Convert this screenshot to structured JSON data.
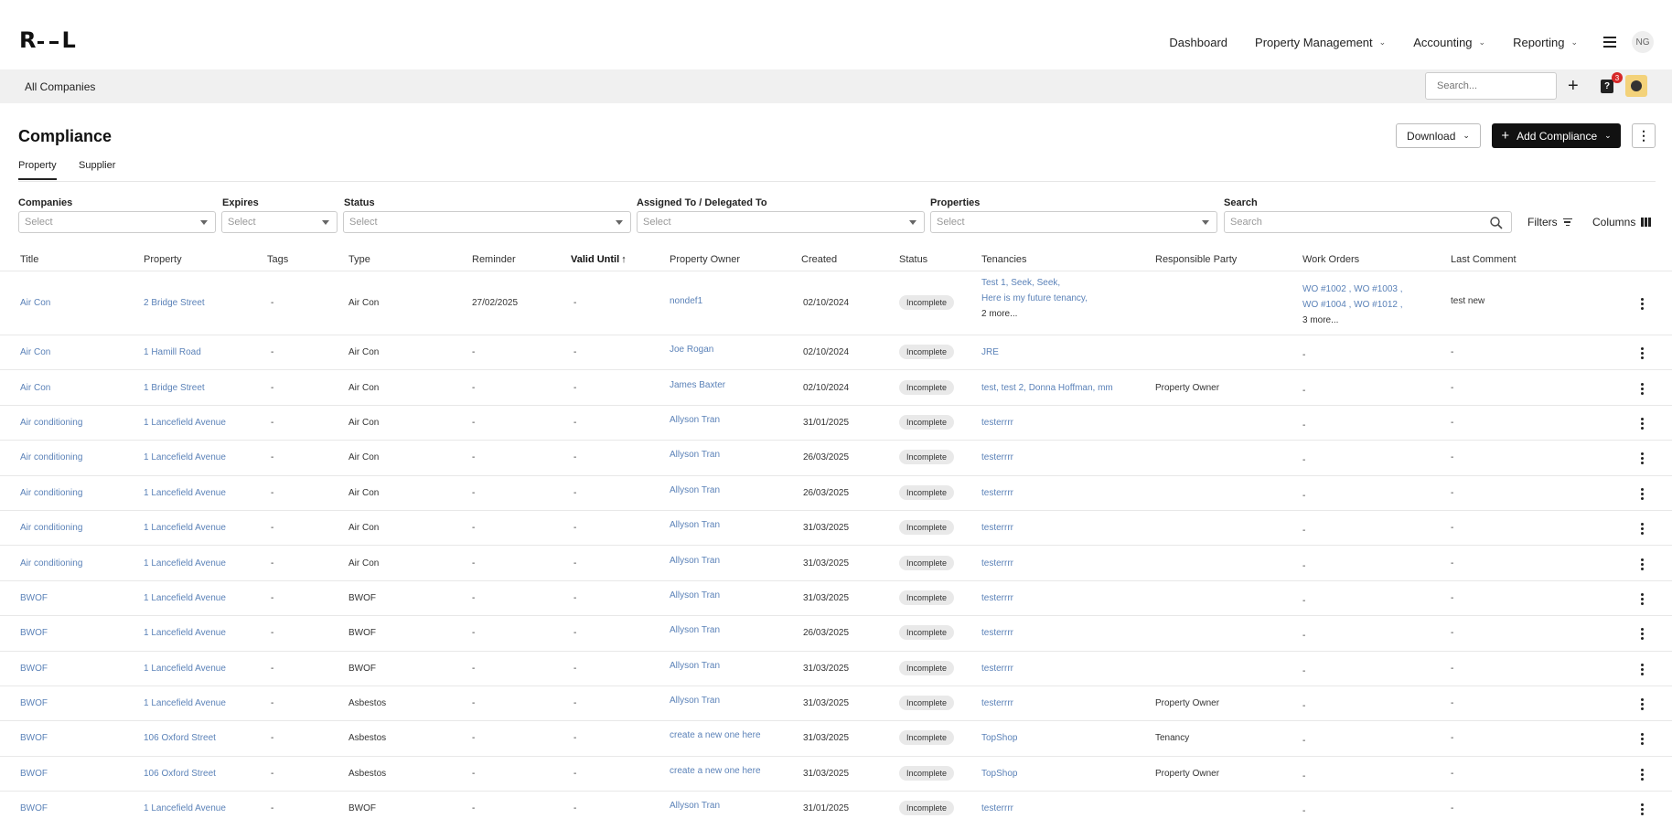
{
  "nav": {
    "logo_left": "R",
    "logo_right": "L",
    "links": [
      {
        "label": "Dashboard",
        "dropdown": false
      },
      {
        "label": "Property Management",
        "dropdown": true
      },
      {
        "label": "Accounting",
        "dropdown": true
      },
      {
        "label": "Reporting",
        "dropdown": true
      }
    ],
    "avatar": "NG"
  },
  "subbar": {
    "company": "All Companies",
    "search_placeholder": "Search...",
    "help_badge": "3"
  },
  "page": {
    "title": "Compliance",
    "tabs": [
      "Property",
      "Supplier"
    ],
    "download_label": "Download",
    "add_label": "Add Compliance"
  },
  "filters": {
    "companies": {
      "label": "Companies",
      "placeholder": "Select"
    },
    "expires": {
      "label": "Expires",
      "placeholder": "Select"
    },
    "status": {
      "label": "Status",
      "placeholder": "Select"
    },
    "assigned": {
      "label": "Assigned To / Delegated To",
      "placeholder": "Select"
    },
    "properties": {
      "label": "Properties",
      "placeholder": "Select"
    },
    "search": {
      "label": "Search",
      "placeholder": "Search"
    },
    "filters_label": "Filters",
    "columns_label": "Columns"
  },
  "table": {
    "headers": [
      "Title",
      "Property",
      "Tags",
      "Type",
      "Reminder",
      "Valid Until",
      "Property Owner",
      "Created",
      "Status",
      "Tenancies",
      "Responsible Party",
      "Work Orders",
      "Last Comment"
    ],
    "rows": [
      {
        "title": "Air Con",
        "property": "2 Bridge Street",
        "tags": "-",
        "type": "Air Con",
        "reminder": "27/02/2025",
        "valid": "-",
        "owner": "nondef1",
        "created": "02/10/2024",
        "status": "Incomplete",
        "tenancies": [
          "Test 1,  Seek,  Seek,",
          "Here is my future tenancy,",
          "2 more..."
        ],
        "responsible": "",
        "workorders": [
          "WO #1002 ,  WO #1003 ,",
          "WO #1004 ,  WO #1012 ,",
          "3 more..."
        ],
        "comment": "test new"
      },
      {
        "title": "Air Con",
        "property": "1 Hamill Road",
        "tags": "-",
        "type": "Air Con",
        "reminder": "-",
        "valid": "-",
        "owner": "Joe Rogan",
        "created": "02/10/2024",
        "status": "Incomplete",
        "tenancies": [
          "JRE"
        ],
        "responsible": "",
        "workorders": [
          "-"
        ],
        "comment": "-"
      },
      {
        "title": "Air Con",
        "property": "1 Bridge Street",
        "tags": "-",
        "type": "Air Con",
        "reminder": "-",
        "valid": "-",
        "owner": "James Baxter",
        "created": "02/10/2024",
        "status": "Incomplete",
        "tenancies": [
          "test,  test 2,  Donna Hoffman,  mm"
        ],
        "responsible": "Property Owner",
        "workorders": [
          "-"
        ],
        "comment": "-"
      },
      {
        "title": "Air conditioning",
        "property": "1 Lancefield Avenue",
        "tags": "-",
        "type": "Air Con",
        "reminder": "-",
        "valid": "-",
        "owner": "Allyson Tran",
        "created": "31/01/2025",
        "status": "Incomplete",
        "tenancies": [
          "testerrrr"
        ],
        "responsible": "",
        "workorders": [
          "-"
        ],
        "comment": "-"
      },
      {
        "title": "Air conditioning",
        "property": "1 Lancefield Avenue",
        "tags": "-",
        "type": "Air Con",
        "reminder": "-",
        "valid": "-",
        "owner": "Allyson Tran",
        "created": "26/03/2025",
        "status": "Incomplete",
        "tenancies": [
          "testerrrr"
        ],
        "responsible": "",
        "workorders": [
          "-"
        ],
        "comment": "-"
      },
      {
        "title": "Air conditioning",
        "property": "1 Lancefield Avenue",
        "tags": "-",
        "type": "Air Con",
        "reminder": "-",
        "valid": "-",
        "owner": "Allyson Tran",
        "created": "26/03/2025",
        "status": "Incomplete",
        "tenancies": [
          "testerrrr"
        ],
        "responsible": "",
        "workorders": [
          "-"
        ],
        "comment": "-"
      },
      {
        "title": "Air conditioning",
        "property": "1 Lancefield Avenue",
        "tags": "-",
        "type": "Air Con",
        "reminder": "-",
        "valid": "-",
        "owner": "Allyson Tran",
        "created": "31/03/2025",
        "status": "Incomplete",
        "tenancies": [
          "testerrrr"
        ],
        "responsible": "",
        "workorders": [
          "-"
        ],
        "comment": "-"
      },
      {
        "title": "Air conditioning",
        "property": "1 Lancefield Avenue",
        "tags": "-",
        "type": "Air Con",
        "reminder": "-",
        "valid": "-",
        "owner": "Allyson Tran",
        "created": "31/03/2025",
        "status": "Incomplete",
        "tenancies": [
          "testerrrr"
        ],
        "responsible": "",
        "workorders": [
          "-"
        ],
        "comment": "-"
      },
      {
        "title": "BWOF",
        "property": "1 Lancefield Avenue",
        "tags": "-",
        "type": "BWOF",
        "reminder": "-",
        "valid": "-",
        "owner": "Allyson Tran",
        "created": "31/03/2025",
        "status": "Incomplete",
        "tenancies": [
          "testerrrr"
        ],
        "responsible": "",
        "workorders": [
          "-"
        ],
        "comment": "-"
      },
      {
        "title": "BWOF",
        "property": "1 Lancefield Avenue",
        "tags": "-",
        "type": "BWOF",
        "reminder": "-",
        "valid": "-",
        "owner": "Allyson Tran",
        "created": "26/03/2025",
        "status": "Incomplete",
        "tenancies": [
          "testerrrr"
        ],
        "responsible": "",
        "workorders": [
          "-"
        ],
        "comment": "-"
      },
      {
        "title": "BWOF",
        "property": "1 Lancefield Avenue",
        "tags": "-",
        "type": "BWOF",
        "reminder": "-",
        "valid": "-",
        "owner": "Allyson Tran",
        "created": "31/03/2025",
        "status": "Incomplete",
        "tenancies": [
          "testerrrr"
        ],
        "responsible": "",
        "workorders": [
          "-"
        ],
        "comment": "-"
      },
      {
        "title": "BWOF",
        "property": "1 Lancefield Avenue",
        "tags": "-",
        "type": "Asbestos",
        "reminder": "-",
        "valid": "-",
        "owner": "Allyson Tran",
        "created": "31/03/2025",
        "status": "Incomplete",
        "tenancies": [
          "testerrrr"
        ],
        "responsible": "Property Owner",
        "workorders": [
          "-"
        ],
        "comment": "-"
      },
      {
        "title": "BWOF",
        "property": "106 Oxford Street",
        "tags": "-",
        "type": "Asbestos",
        "reminder": "-",
        "valid": "-",
        "owner": "create a new one here",
        "created": "31/03/2025",
        "status": "Incomplete",
        "tenancies": [
          "TopShop"
        ],
        "responsible": "Tenancy",
        "workorders": [
          "-"
        ],
        "comment": "-"
      },
      {
        "title": "BWOF",
        "property": "106 Oxford Street",
        "tags": "-",
        "type": "Asbestos",
        "reminder": "-",
        "valid": "-",
        "owner": "create a new one here",
        "created": "31/03/2025",
        "status": "Incomplete",
        "tenancies": [
          "TopShop"
        ],
        "responsible": "Property Owner",
        "workorders": [
          "-"
        ],
        "comment": "-"
      },
      {
        "title": "BWOF",
        "property": "1 Lancefield Avenue",
        "tags": "-",
        "type": "BWOF",
        "reminder": "-",
        "valid": "-",
        "owner": "Allyson Tran",
        "created": "31/01/2025",
        "status": "Incomplete",
        "tenancies": [
          "testerrrr"
        ],
        "responsible": "",
        "workorders": [
          "-"
        ],
        "comment": "-"
      }
    ]
  }
}
